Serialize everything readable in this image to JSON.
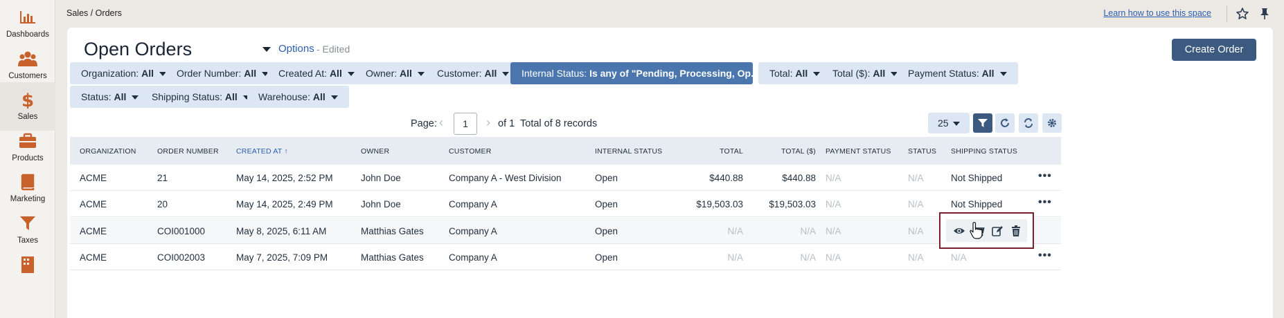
{
  "sidebar": {
    "items": [
      {
        "label": "Dashboards",
        "icon": "chart-bar-icon"
      },
      {
        "label": "Customers",
        "icon": "users-icon"
      },
      {
        "label": "Sales",
        "icon": "dollar-icon"
      },
      {
        "label": "Products",
        "icon": "briefcase-icon"
      },
      {
        "label": "Marketing",
        "icon": "book-icon"
      },
      {
        "label": "Taxes",
        "icon": "funnel-icon"
      },
      {
        "label": "",
        "icon": "building-icon"
      }
    ]
  },
  "topbar": {
    "breadcrumb": "Sales / Orders",
    "learn_link": "Learn how to use this space"
  },
  "page": {
    "title": "Open Orders",
    "options_link": "Options",
    "edited_label": "- Edited",
    "create_button": "Create Order"
  },
  "filters": [
    {
      "name": "Organization:",
      "value": "All"
    },
    {
      "name": "Order Number:",
      "value": "All"
    },
    {
      "name": "Created At:",
      "value": "All"
    },
    {
      "name": "Owner:",
      "value": "All"
    },
    {
      "name": "Customer:",
      "value": "All"
    },
    {
      "name": "Internal Status:",
      "value": "Is any of \"Pending, Processing, Op...",
      "active": true
    },
    {
      "name": "Total:",
      "value": "All"
    },
    {
      "name": "Total ($):",
      "value": "All"
    },
    {
      "name": "Payment Status:",
      "value": "All"
    },
    {
      "name": "Status:",
      "value": "All"
    },
    {
      "name": "Shipping Status:",
      "value": "All"
    },
    {
      "name": "Warehouse:",
      "value": "All"
    }
  ],
  "pagination": {
    "page_label": "Page:",
    "current_page": "1",
    "of_label": "of 1",
    "total_label": "Total of 8 records",
    "per_page": "25"
  },
  "table": {
    "columns": [
      "ORGANIZATION",
      "ORDER NUMBER",
      "CREATED AT",
      "OWNER",
      "CUSTOMER",
      "INTERNAL STATUS",
      "TOTAL",
      "TOTAL ($)",
      "PAYMENT STATUS",
      "STATUS",
      "SHIPPING STATUS"
    ],
    "sorted_column": "CREATED AT",
    "rows": [
      {
        "organization": "ACME",
        "order_number": "21",
        "created_at": "May 14, 2025, 2:52 PM",
        "owner": "John Doe",
        "customer": "Company A - West Division",
        "internal_status": "Open",
        "total": "$440.88",
        "total_usd": "$440.88",
        "payment_status": "N/A",
        "status": "N/A",
        "shipping_status": "Not Shipped"
      },
      {
        "organization": "ACME",
        "order_number": "20",
        "created_at": "May 14, 2025, 2:49 PM",
        "owner": "John Doe",
        "customer": "Company A",
        "internal_status": "Open",
        "total": "$19,503.03",
        "total_usd": "$19,503.03",
        "payment_status": "N/A",
        "status": "N/A",
        "shipping_status": "Not Shipped"
      },
      {
        "organization": "ACME",
        "order_number": "COI001000",
        "created_at": "May 8, 2025, 6:11 AM",
        "owner": "Matthias Gates",
        "customer": "Company A",
        "internal_status": "Open",
        "total": "N/A",
        "total_usd": "N/A",
        "payment_status": "N/A",
        "status": "N/A",
        "shipping_status": ""
      },
      {
        "organization": "ACME",
        "order_number": "COI002003",
        "created_at": "May 7, 2025, 7:09 PM",
        "owner": "Matthias Gates",
        "customer": "Company A",
        "internal_status": "Open",
        "total": "N/A",
        "total_usd": "N/A",
        "payment_status": "N/A",
        "status": "N/A",
        "shipping_status": "N/A"
      }
    ]
  },
  "row_actions": [
    "view-icon",
    "cart-icon",
    "edit-icon",
    "trash-icon"
  ],
  "colors": {
    "primary": "#3c5a80",
    "chip_bg": "#dde7f3",
    "chip_active": "#4a76ad",
    "accent_icon": "#c8612b",
    "highlight_border": "#7a1f2e"
  }
}
